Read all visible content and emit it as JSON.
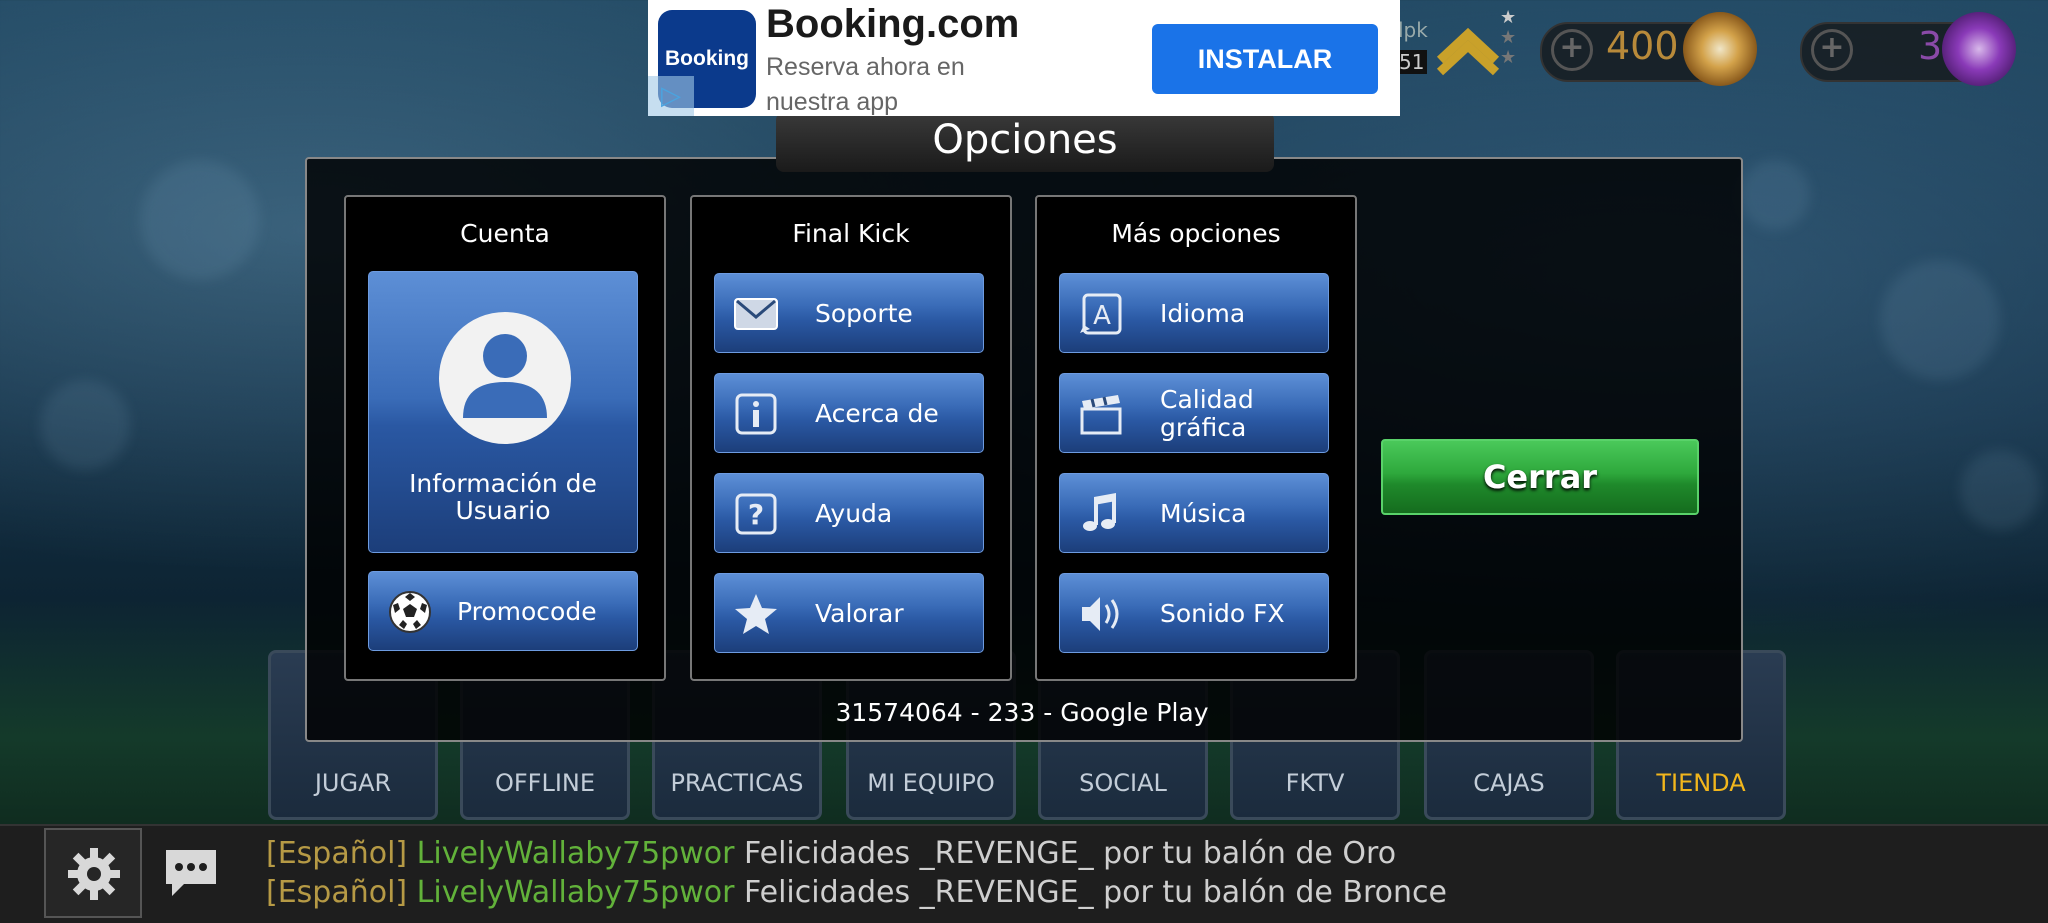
{
  "ad": {
    "logo_text": "Booking",
    "title": "Booking.com",
    "subtitle": "Reserva ahora en nuestra app",
    "install_label": "INSTALAR"
  },
  "hud": {
    "username_partial": "lpk",
    "level_partial": "51",
    "coins": "400",
    "gems": "3"
  },
  "dialog": {
    "title": "Opciones",
    "account": {
      "title": "Cuenta",
      "user_info": "Información de Usuario",
      "promocode": "Promocode"
    },
    "final_kick": {
      "title": "Final Kick",
      "items": [
        "Soporte",
        "Acerca de",
        "Ayuda",
        "Valorar"
      ]
    },
    "more": {
      "title": "Más opciones",
      "items": [
        "Idioma",
        "Calidad gráfica",
        "Música",
        "Sonido FX"
      ]
    },
    "close_label": "Cerrar",
    "build_info": "31574064 - 233 - Google Play"
  },
  "nav": {
    "items": [
      "JUGAR",
      "OFFLINE",
      "PRACTICAS",
      "MI EQUIPO",
      "SOCIAL",
      "FKTV",
      "CAJAS",
      "TIENDA"
    ]
  },
  "chat": {
    "messages": [
      {
        "lang": "[Español]",
        "user": "LivelyWallaby75pwor",
        "text": "Felicidades _REVENGE_ por tu balón de Oro"
      },
      {
        "lang": "[Español]",
        "user": "LivelyWallaby75pwor",
        "text": "Felicidades _REVENGE_ por tu balón de Bronce"
      }
    ]
  },
  "colors": {
    "button_blue": "#3a6cb8",
    "close_green": "#2ea83c",
    "tienda_gold": "#f2b61c",
    "chat_lang": "#b69a45",
    "chat_user": "#62b23a"
  }
}
